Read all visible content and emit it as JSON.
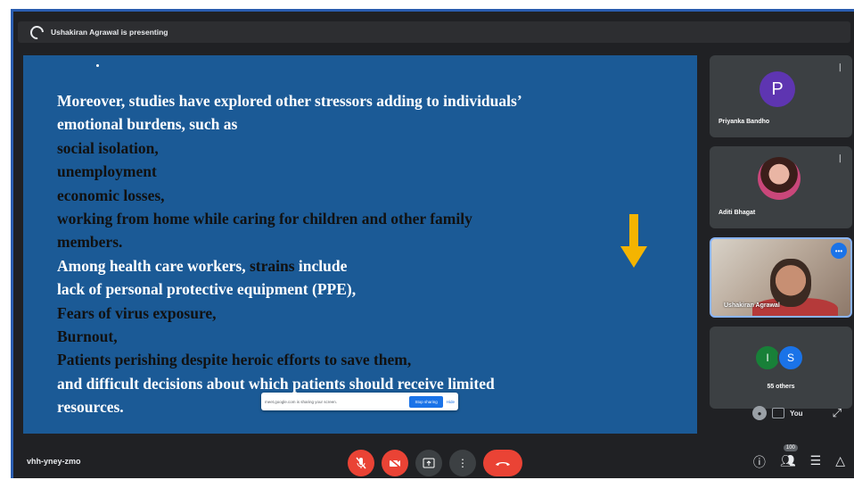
{
  "presenting": {
    "text": "Ushakiran Agrawal is presenting",
    "icon": "presenting-icon"
  },
  "slide": {
    "lines": [
      [
        {
          "t": "Moreover, studies have explored ",
          "w": true
        },
        {
          "t": "other stressors adding to individuals’",
          "w": true
        }
      ],
      [
        {
          "t": "emotional burdens, such as",
          "w": true
        }
      ],
      [
        {
          "t": "social isolation,",
          "w": false
        }
      ],
      [
        {
          "t": "unemployment",
          "w": false
        }
      ],
      [
        {
          "t": "economic losses,",
          "w": false
        }
      ],
      [
        {
          "t": " working from home while caring for children and other family",
          "w": false
        }
      ],
      [
        {
          "t": "members.",
          "w": false
        }
      ],
      [
        {
          "t": "Among health care workers, ",
          "w": true
        },
        {
          "t": "strains",
          "w": false
        },
        {
          "t": " include",
          "w": true
        }
      ],
      [
        {
          "t": "lack of ",
          "w": true
        },
        {
          "t": "personal protective equipment (PPE),",
          "w": true
        }
      ],
      [
        {
          "t": " Fears of virus exposure,",
          "w": false
        }
      ],
      [
        {
          "t": " Burnout,",
          "w": false
        }
      ],
      [
        {
          "t": " Patients perishing despite heroic efforts to save them,",
          "w": false
        }
      ],
      [
        {
          "t": "and difficult decisions about which patients should receive limited",
          "w": true
        }
      ],
      [
        {
          "t": "resources.",
          "w": true
        }
      ]
    ],
    "arrow_color": "#f4b400",
    "background": "#1b5a96"
  },
  "share_pill": {
    "message": "meet.google.com is sharing your screen.",
    "stop_label": "Stop sharing",
    "hide_label": "Hide"
  },
  "participants": [
    {
      "name": "Priyanka Bandho",
      "initial": "P",
      "color": "#5e35b1"
    },
    {
      "name": "Aditi Bhagat"
    },
    {
      "name": "Ushakiran Agrawal"
    }
  ],
  "others": {
    "initials": [
      "I",
      "S"
    ],
    "colors": [
      "#188038",
      "#1a73e8"
    ],
    "label": "55 others"
  },
  "self_view": {
    "label": "You"
  },
  "bottom_bar": {
    "meeting_code": "vhh-yney-zmo",
    "participants_badge": "100",
    "icons": [
      "mic-off-icon",
      "camera-off-icon",
      "present-icon",
      "more-options-icon",
      "end-call-icon",
      "info-icon",
      "people-icon",
      "chat-icon",
      "activities-icon"
    ]
  }
}
